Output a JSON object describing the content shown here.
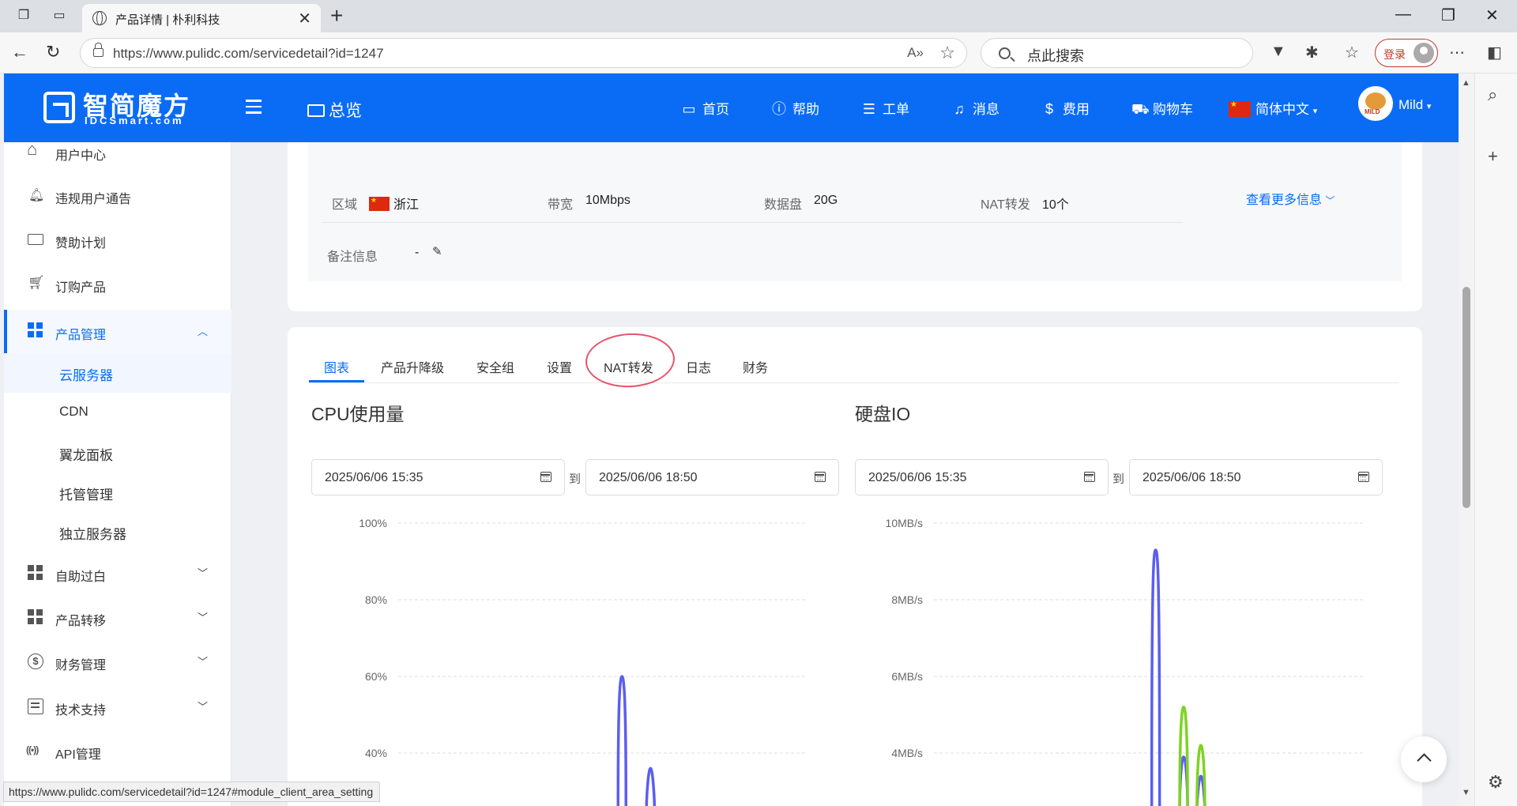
{
  "browser": {
    "tab_title": "产品详情 | 朴利科技",
    "url": "https://www.pulidc.com/servicedetail?id=1247",
    "search_placeholder": "点此搜索",
    "login_label": "登录",
    "status_url": "https://www.pulidc.com/servicedetail?id=1247#module_client_area_setting"
  },
  "header": {
    "logo_name": "智简魔方",
    "logo_sub": "IDCSmart.com",
    "overview": "总览",
    "nav": [
      "首页",
      "帮助",
      "工单",
      "消息",
      "费用",
      "购物车"
    ],
    "language": "简体中文",
    "user": "Mild"
  },
  "sidebar": {
    "items": [
      {
        "label": "用户中心",
        "icon": "home-icon"
      },
      {
        "label": "违规用户通告",
        "icon": "bell-icon"
      },
      {
        "label": "赞助计划",
        "icon": "card-icon"
      },
      {
        "label": "订购产品",
        "icon": "cart-icon"
      },
      {
        "label": "产品管理",
        "icon": "grid-icon"
      },
      {
        "label": "自助过白",
        "icon": "grid-icon"
      },
      {
        "label": "产品转移",
        "icon": "grid-icon"
      },
      {
        "label": "财务管理",
        "icon": "dollar-icon"
      },
      {
        "label": "技术支持",
        "icon": "doc-icon"
      },
      {
        "label": "API管理",
        "icon": "api-icon"
      }
    ],
    "subitems": [
      "云服务器",
      "CDN",
      "翼龙面板",
      "托管管理",
      "独立服务器"
    ]
  },
  "info": {
    "region_label": "区域",
    "region_value": "浙江",
    "bandwidth_label": "带宽",
    "bandwidth_value": "10Mbps",
    "disk_label": "数据盘",
    "disk_value": "20G",
    "nat_label": "NAT转发",
    "nat_value": "10个",
    "more": "查看更多信息",
    "remark_label": "备注信息",
    "remark_value": "-"
  },
  "tabs": [
    "图表",
    "产品升降级",
    "安全组",
    "设置",
    "NAT转发",
    "日志",
    "财务"
  ],
  "charts": {
    "date_to": "到",
    "cpu": {
      "title": "CPU使用量",
      "start": "2025/06/06  15:35",
      "end": "2025/06/06  18:50"
    },
    "disk": {
      "title": "硬盘IO",
      "start": "2025/06/06  15:35",
      "end": "2025/06/06  18:50"
    }
  },
  "chart_data": [
    {
      "type": "line",
      "title": "CPU使用量",
      "yticks": [
        "100%",
        "80%",
        "60%",
        "40%"
      ],
      "ylim": [
        0,
        100
      ],
      "series": [
        {
          "color": "#5b5ef0",
          "peaks": [
            {
              "x": 0.55,
              "value": 60
            },
            {
              "x": 0.62,
              "value": 36
            }
          ]
        }
      ]
    },
    {
      "type": "line",
      "title": "硬盘IO",
      "yticks": [
        "10MB/s",
        "8MB/s",
        "6MB/s",
        "4MB/s"
      ],
      "ylim": [
        0,
        10
      ],
      "series": [
        {
          "color": "#5b5ef0",
          "peaks": [
            {
              "x": 0.515,
              "value": 9.3
            },
            {
              "x": 0.58,
              "value": 3.9
            },
            {
              "x": 0.62,
              "value": 3.4
            }
          ]
        },
        {
          "color": "#7ed321",
          "peaks": [
            {
              "x": 0.58,
              "value": 5.2
            },
            {
              "x": 0.62,
              "value": 4.2
            }
          ]
        }
      ]
    }
  ],
  "colors": {
    "brand": "#0a6cf5",
    "annotation": "#e8536b"
  }
}
